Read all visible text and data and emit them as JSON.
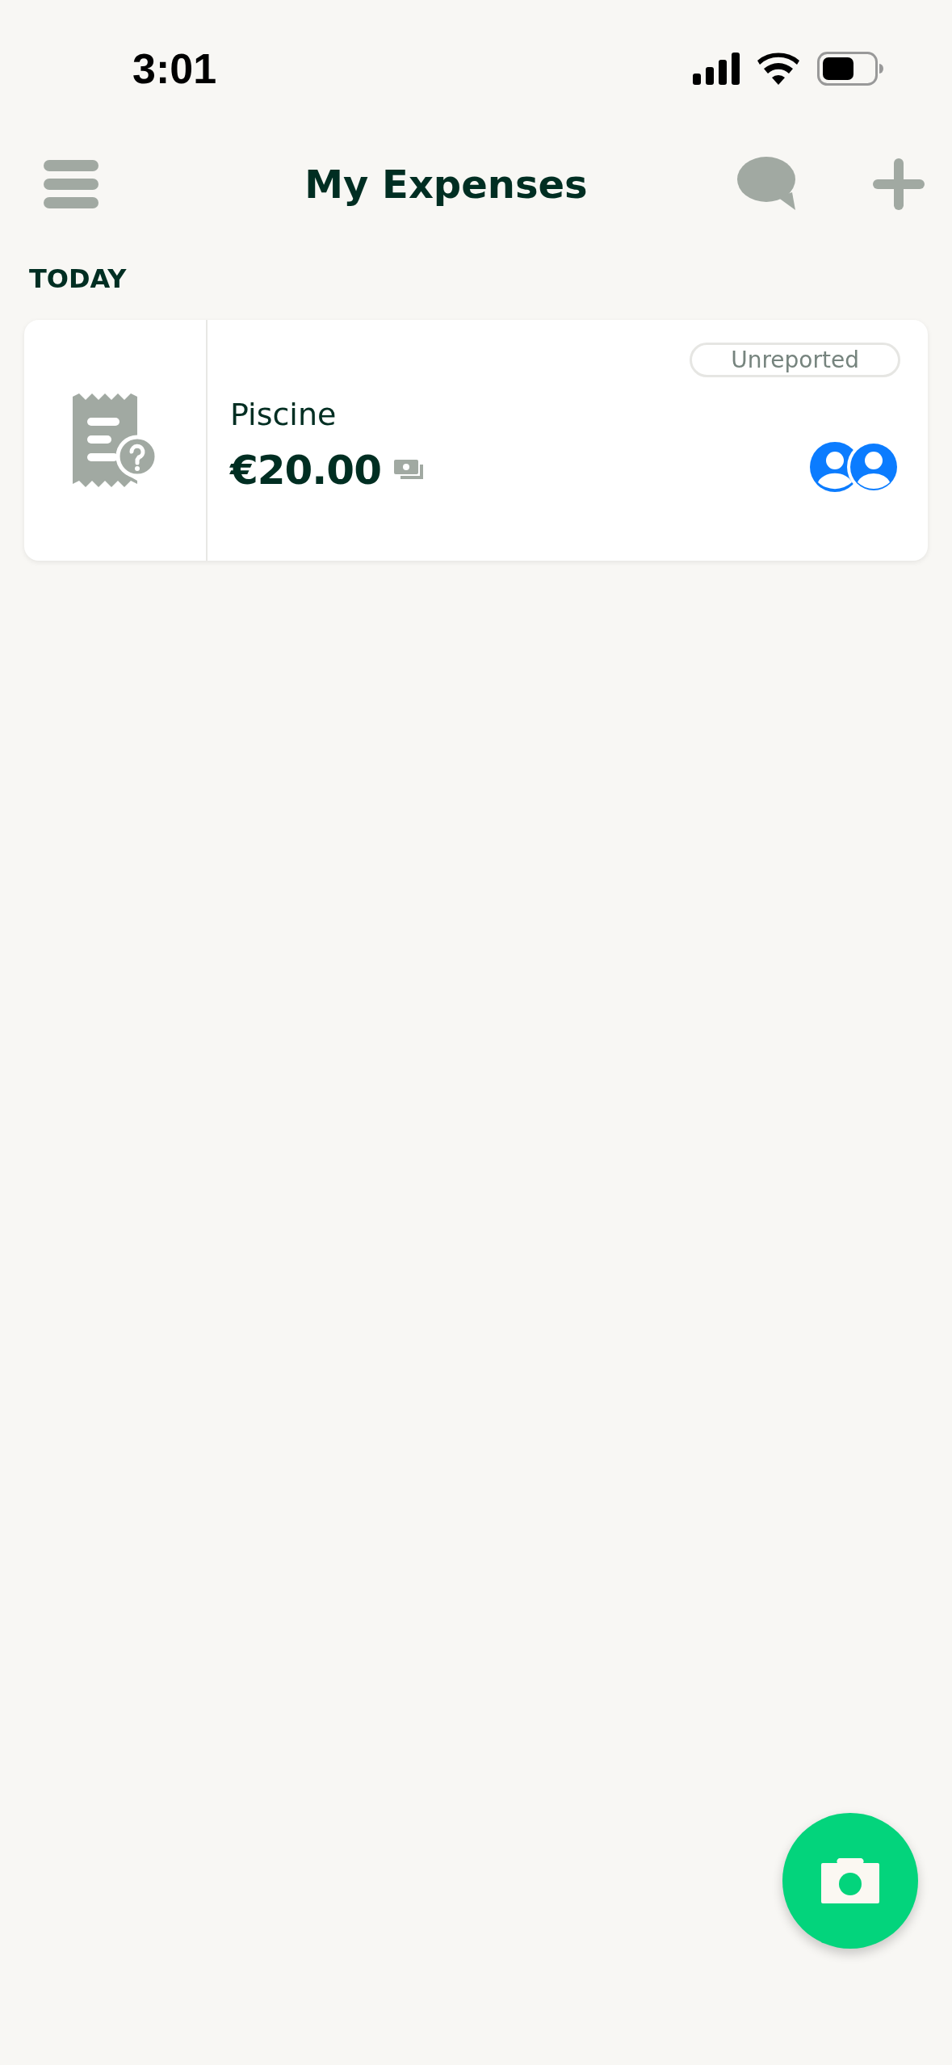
{
  "status_bar": {
    "time": "3:01"
  },
  "header": {
    "title": "My Expenses"
  },
  "sections": [
    {
      "label": "TODAY",
      "expenses": [
        {
          "merchant": "Piscine",
          "amount": "€20.00",
          "status": "Unreported"
        }
      ]
    }
  ]
}
